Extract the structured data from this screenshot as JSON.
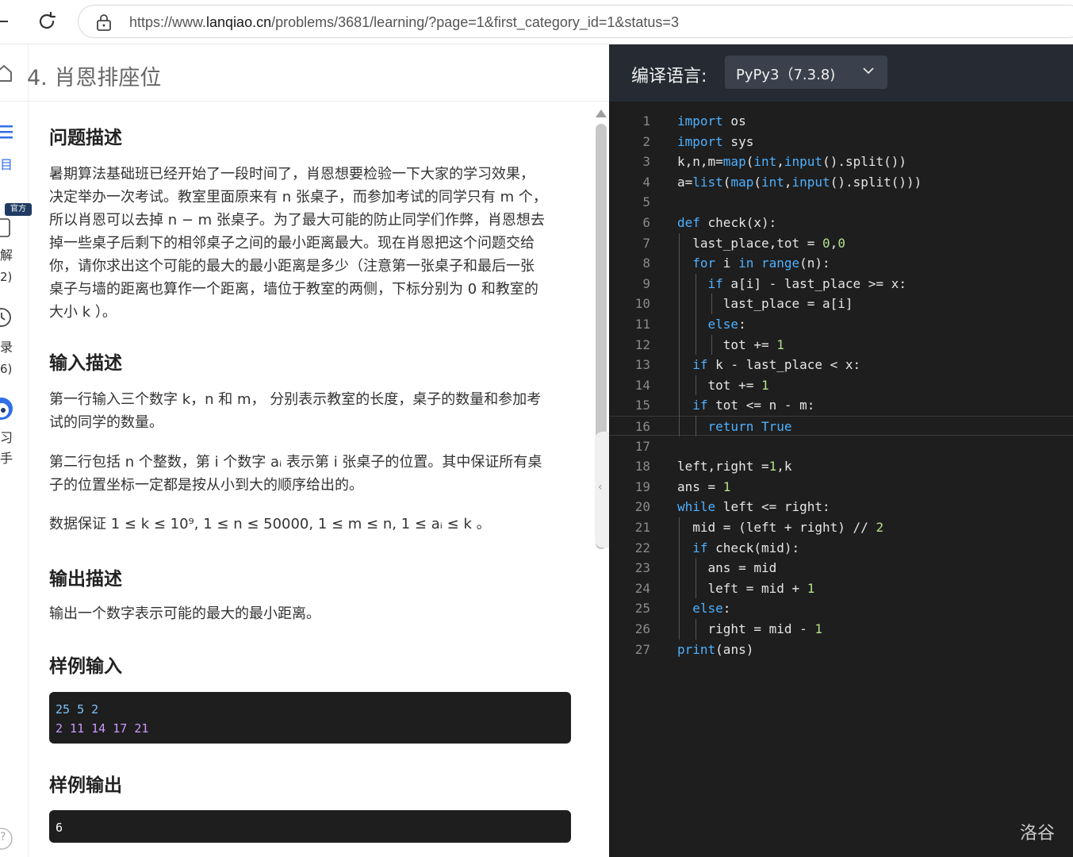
{
  "browser": {
    "url_prefix": "https://www.",
    "url_domain": "lanqiao.cn",
    "url_path": "/problems/3681/learning/?page=1&first_category_id=1&status=3"
  },
  "left_rail": {
    "item1": "目",
    "badge": "官方",
    "item2": "解",
    "item2_count": "2)",
    "item3": "录",
    "item3_count": "6)",
    "item4a": "习",
    "item4b": "手",
    "help": "?"
  },
  "problem": {
    "title": "4. 肖恩排座位"
  },
  "sections": {
    "desc_title": "问题描述",
    "desc_lines": [
      "暑期算法基础班已经开始了一段时间了，肖恩想要检验一下大家的学习效果，",
      "决定举办一次考试。教室里面原来有 n 张桌子，而参加考试的同学只有 m 个，",
      "所以肖恩可以去掉 n − m 张桌子。为了最大可能的防止同学们作弊，肖恩想去",
      "掉一些桌子后剩下的相邻桌子之间的最小距离最大。现在肖恩把这个问题交给",
      "你，请你求出这个可能的最大的最小距离是多少（注意第一张桌子和最后一张",
      "桌子与墙的距离也算作一个距离，墙位于教室的两侧，下标分别为 0 和教室的",
      "大小 k ）。"
    ],
    "input_title": "输入描述",
    "input_lines_1": [
      "第一行输入三个数字 k，n 和 m， 分别表示教室的长度，桌子的数量和参加考",
      "试的同学的数量。"
    ],
    "input_lines_2": [
      "第二行包括 n 个整数，第 i 个数字 aᵢ 表示第 i 张桌子的位置。其中保证所有桌",
      "子的位置坐标一定都是按从小到大的顺序给出的。"
    ],
    "input_range": "数据保证 1 ≤ k ≤ 10⁹, 1 ≤ n ≤ 50000, 1 ≤ m ≤ n, 1 ≤ aᵢ ≤ k 。",
    "output_title": "输出描述",
    "output_text": "输出一个数字表示可能的最大的最小距离。",
    "sample_in_title": "样例输入",
    "sample_in": [
      "25 5 2",
      "2 11 14 17 21"
    ],
    "sample_out_title": "样例输出",
    "sample_out": "6"
  },
  "editor": {
    "lang_label": "编译语言:",
    "lang_value": "PyPy3（7.3.8)",
    "lines": [
      "import os",
      "import sys",
      "k,n,m=map(int,input().split())",
      "a=list(map(int,input().split()))",
      "",
      "def check(x):",
      "  last_place,tot = 0,0",
      "  for i in range(n):",
      "    if a[i] - last_place >= x:",
      "      last_place = a[i]",
      "    else:",
      "      tot += 1",
      "  if k - last_place < x:",
      "    tot += 1",
      "  if tot <= n - m:",
      "    return True",
      "",
      "left,right =1,k",
      "ans = 1",
      "while left <= right:",
      "  mid = (left + right) // 2",
      "  if check(mid):",
      "    ans = mid",
      "    left = mid + 1",
      "  else:",
      "    right = mid - 1",
      "print(ans)"
    ]
  },
  "watermark": "洛谷",
  "colors": {
    "editor_bg": "#1e1e1e",
    "keyword": "#4fb0ff",
    "number": "#b5e08a",
    "badge": "#1f3b63"
  }
}
